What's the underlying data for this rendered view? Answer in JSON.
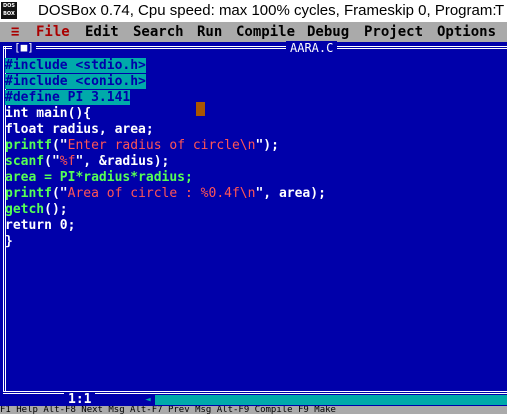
{
  "window": {
    "title": "DOSBox 0.74, Cpu speed: max 100% cycles, Frameskip  0, Program:",
    "title_overflow": "T",
    "icon": "dosbox-icon"
  },
  "menu": {
    "system": "≡",
    "items": [
      "File",
      "Edit",
      "Search",
      "Run",
      "Compile",
      "Debug",
      "Project",
      "Options"
    ]
  },
  "editor": {
    "close_box": "[■]",
    "filename": "AARA.C",
    "lines": [
      "#include <stdio.h>",
      "#include <conio.h>",
      "#define PI 3.141",
      "int main(){",
      "float radius, area;",
      "printf(\"Enter radius of circle\\n\");",
      "scanf(\"%f\", &radius);",
      "area = PI*radius*radius;",
      "printf(\"Area of circle : %0.4f\\n\", area);",
      "getch();",
      "return 0;",
      "}"
    ]
  },
  "status": {
    "position": "1:1",
    "fkeys": "F1 Help  Alt-F8 Next Msg  Alt-F7 Prev Msg  Alt-F9 Compile  F9 Make"
  },
  "colors": {
    "editor_bg": "#0000aa",
    "menu_bg": "#aaaaaa",
    "hotkey": "#aa0000",
    "preprocessor_bg": "#00aaaa",
    "string": "#ff5555",
    "function": "#55ff55",
    "cursor": "#aa5500"
  }
}
